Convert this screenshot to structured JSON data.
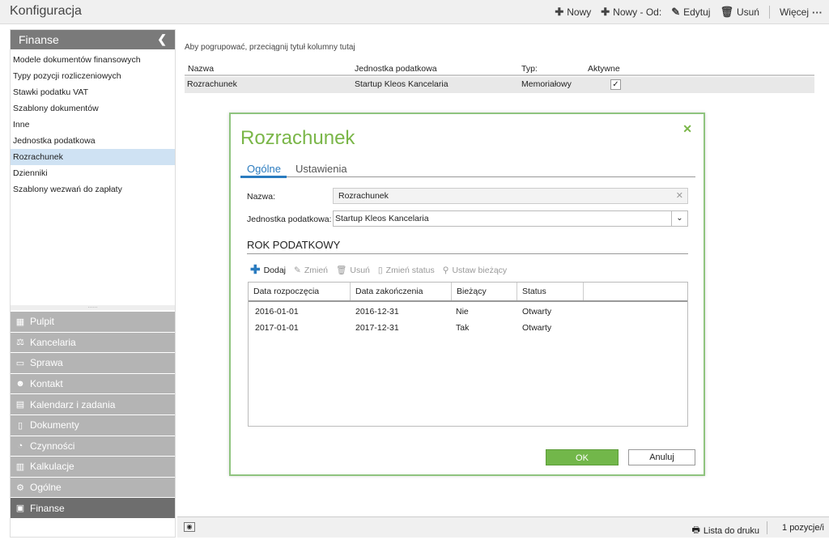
{
  "app": {
    "title": "Konfiguracja"
  },
  "toolbar": {
    "new_label": "Nowy",
    "new_from_label": "Nowy - Od:",
    "edit_label": "Edytuj",
    "delete_label": "Usuń",
    "more_label": "Więcej"
  },
  "sidebar": {
    "header": "Finanse",
    "items": [
      {
        "label": "Modele dokumentów finansowych"
      },
      {
        "label": "Typy pozycji rozliczeniowych"
      },
      {
        "label": "Stawki podatku VAT"
      },
      {
        "label": "Szablony dokumentów"
      },
      {
        "label": "Inne"
      },
      {
        "label": "Jednostka podatkowa"
      },
      {
        "label": "Rozrachunek"
      },
      {
        "label": "Dzienniki"
      },
      {
        "label": "Szablony wezwań do zapłaty"
      }
    ],
    "active_item": "Rozrachunek",
    "modules": [
      {
        "label": "Pulpit",
        "icon": "dashboard-icon"
      },
      {
        "label": "Kancelaria",
        "icon": "office-icon"
      },
      {
        "label": "Sprawa",
        "icon": "folder-icon"
      },
      {
        "label": "Kontakt",
        "icon": "contacts-icon"
      },
      {
        "label": "Kalendarz i zadania",
        "icon": "calendar-icon"
      },
      {
        "label": "Dokumenty",
        "icon": "document-icon"
      },
      {
        "label": "Czynności",
        "icon": "activity-icon"
      },
      {
        "label": "Kalkulacje",
        "icon": "calculator-icon"
      },
      {
        "label": "Ogólne",
        "icon": "settings-icon"
      },
      {
        "label": "Finanse",
        "icon": "finance-icon"
      }
    ]
  },
  "main": {
    "group_hint": "Aby pogrupować, przeciągnij tytuł kolumny tutaj",
    "columns": [
      "Nazwa",
      "Jednostka podatkowa",
      "Typ:",
      "Aktywne"
    ],
    "rows": [
      {
        "name": "Rozrachunek",
        "unit": "Startup Kleos Kancelaria",
        "type": "Memoriałowy",
        "active": "✓"
      }
    ]
  },
  "bottombar": {
    "print_label": "Lista do druku",
    "count_label": "1 pozycje/i"
  },
  "dialog": {
    "title": "Rozrachunek",
    "tabs": [
      "Ogólne",
      "Ustawienia"
    ],
    "name_label": "Nazwa:",
    "name_value": "Rozrachunek",
    "unit_label": "Jednostka podatkowa:",
    "unit_value": "Startup Kleos Kancelaria",
    "section_title": "ROK PODATKOWY",
    "mini_toolbar": {
      "add": "Dodaj",
      "edit": "Zmień",
      "delete": "Usuń",
      "change_status": "Zmień status",
      "set_current": "Ustaw bieżący"
    },
    "grid_columns": [
      "Data rozpoczęcia",
      "Data zakończenia",
      "Bieżący",
      "Status"
    ],
    "grid_rows": [
      {
        "start": "2016-01-01",
        "end": "2016-12-31",
        "current": "Nie",
        "status": "Otwarty"
      },
      {
        "start": "2017-01-01",
        "end": "2017-12-31",
        "current": "Tak",
        "status": "Otwarty"
      }
    ],
    "ok_label": "OK",
    "cancel_label": "Anuluj"
  },
  "colors": {
    "accent_green": "#7ab648",
    "tab_blue": "#2a7bbf",
    "sidebar_header": "#7a7a7a",
    "module_bg": "#b4b4b4",
    "selected_row": "#cfe2f3"
  }
}
